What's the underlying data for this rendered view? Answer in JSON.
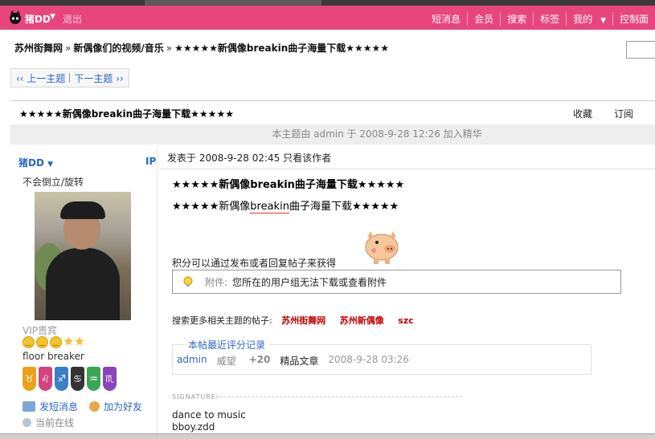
{
  "header": {
    "username": "猪DD",
    "logout": "退出",
    "nav": [
      "短消息",
      "会员",
      "搜索",
      "标签",
      "我的",
      "控制面"
    ]
  },
  "breadcrumb": [
    "苏州街舞网",
    "新偶像们的视频/音乐",
    "★★★★★新偶像breakin曲子海量下载★★★★★"
  ],
  "pager": {
    "prev": "‹‹ 上一主题",
    "next": "下一主题 ››"
  },
  "thread": {
    "title": "★★★★★新偶像breakin曲子海量下载★★★★★",
    "actions": [
      "收藏",
      "订阅"
    ],
    "notice": "本主题由 admin 于 2008-9-28 12:26 加入精华"
  },
  "author": {
    "name": "猪DD",
    "ip_label": "IP",
    "motto": "不会倒立/旋转",
    "rank": "VIP贵宾",
    "title": "floor breaker",
    "send_msg": "发短消息",
    "add_friend": "加为好友",
    "online": "当前在线"
  },
  "post": {
    "posted": "发表于  2008-9-28 02:45  只看该作者",
    "title": "★★★★★新偶像breakin曲子海量下载★★★★★",
    "body_pre": "★★★★★新偶像",
    "body_u": "breakin",
    "body_post": "曲子海量下载★★★★★",
    "earn": "积分可以通过发布或者回复帖子来获得",
    "attach_label": "附件:",
    "attach_msg": "您所在的用户组无法下载或查看附件",
    "related_label": "搜索更多相关主题的帖子:",
    "related_tags": [
      "苏州街舞网",
      "苏州新偶像",
      "szc"
    ],
    "rating_legend": "本帖最近评分记录",
    "rating_user": "admin",
    "rating_field": "威望",
    "rating_value": "+20",
    "rating_reason": "精品文章",
    "rating_time": "2008-9-28 03:26",
    "sig_label": "SIGNATURE:",
    "sig_line1": "dance to music",
    "sig_line2": "bboy.zdd"
  },
  "colors": {
    "topbar": "#e8457c",
    "link": "#2a66c8",
    "tag": "#c00000"
  }
}
